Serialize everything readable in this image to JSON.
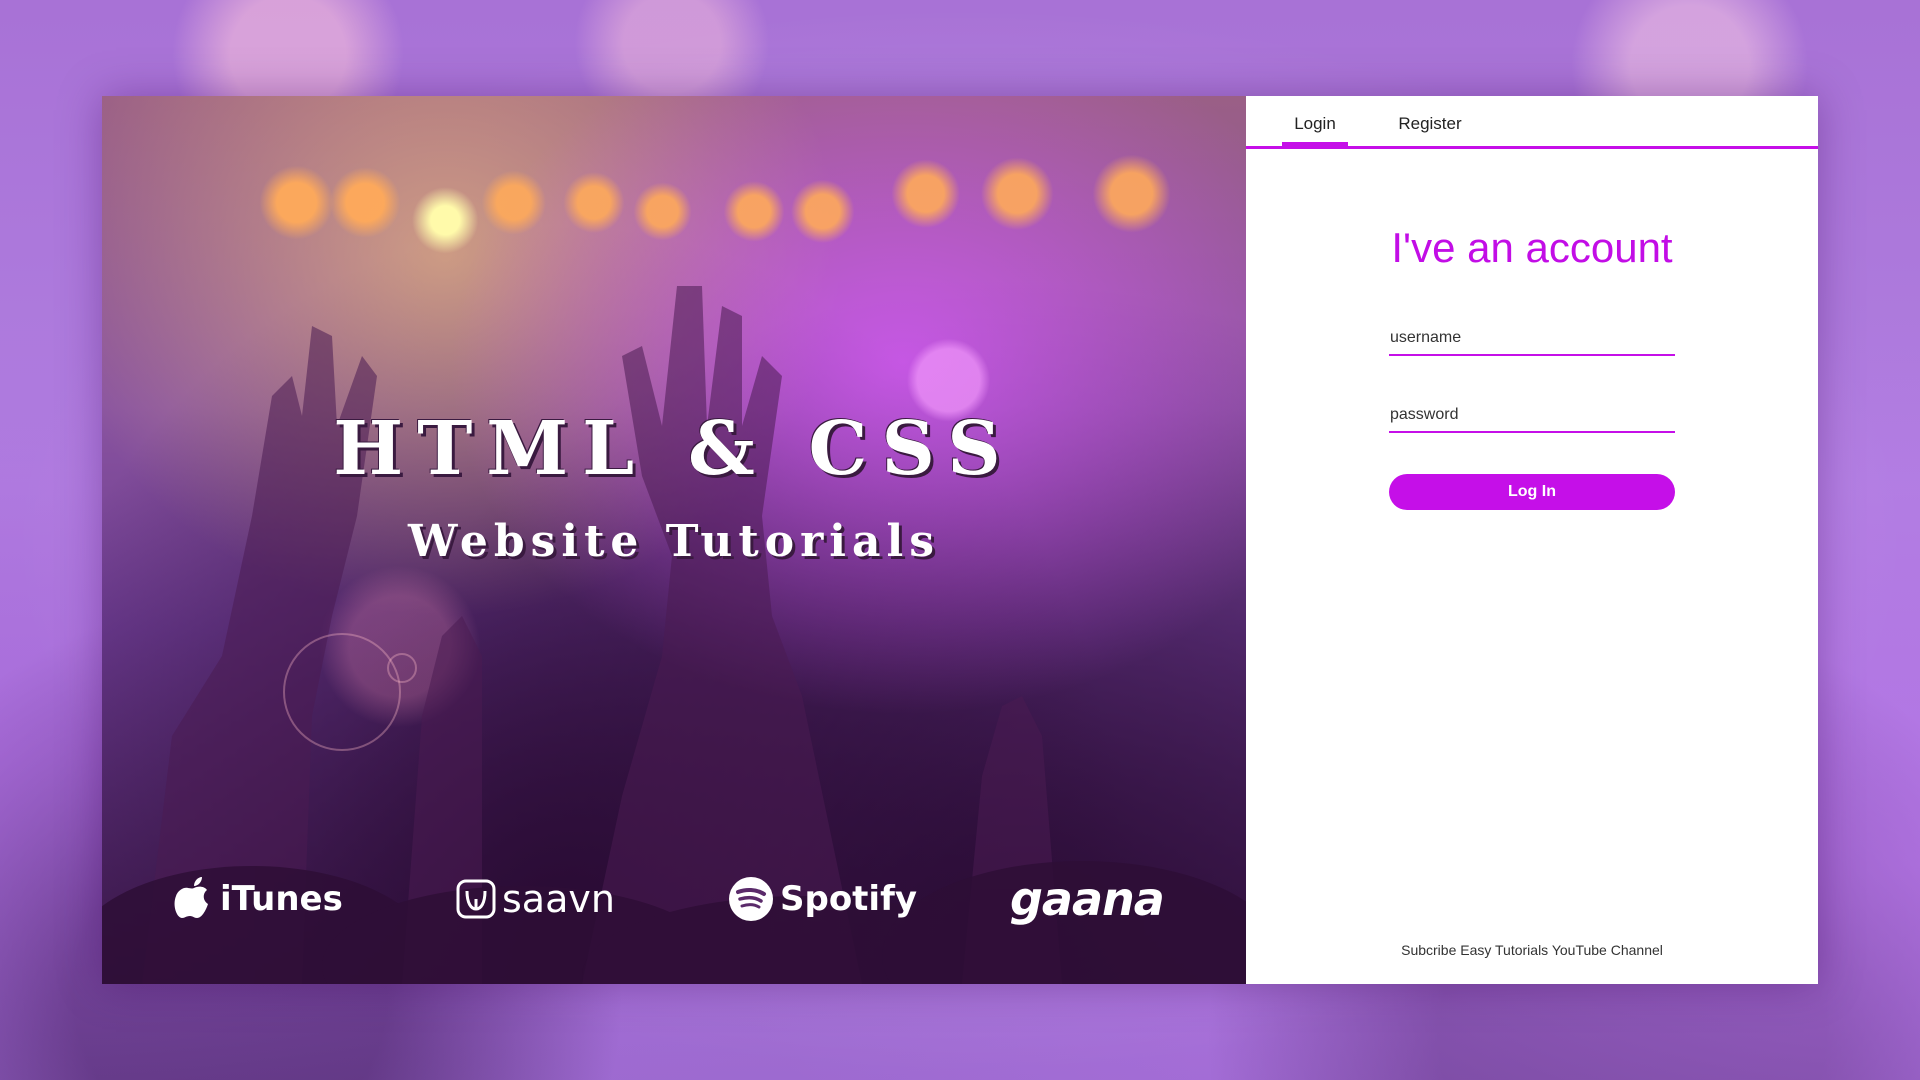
{
  "hero": {
    "title": "HTML & CSS",
    "subtitle": "Website Tutorials",
    "brands": [
      {
        "name": "iTunes",
        "icon": "apple-icon"
      },
      {
        "name": "saavn",
        "icon": "saavn-icon"
      },
      {
        "name": "Spotify",
        "icon": "spotify-icon"
      },
      {
        "name": "gaana",
        "icon": ""
      }
    ]
  },
  "panel": {
    "tabs": [
      {
        "label": "Login",
        "active": true
      },
      {
        "label": "Register",
        "active": false
      }
    ],
    "heading": "I've an account",
    "username_placeholder": "username",
    "password_placeholder": "password",
    "login_button": "Log In",
    "footer": "Subcribe Easy Tutorials YouTube Channel"
  },
  "colors": {
    "accent": "#c50fe8",
    "heading": "#c20de6",
    "panel_bg": "#ffffff"
  }
}
